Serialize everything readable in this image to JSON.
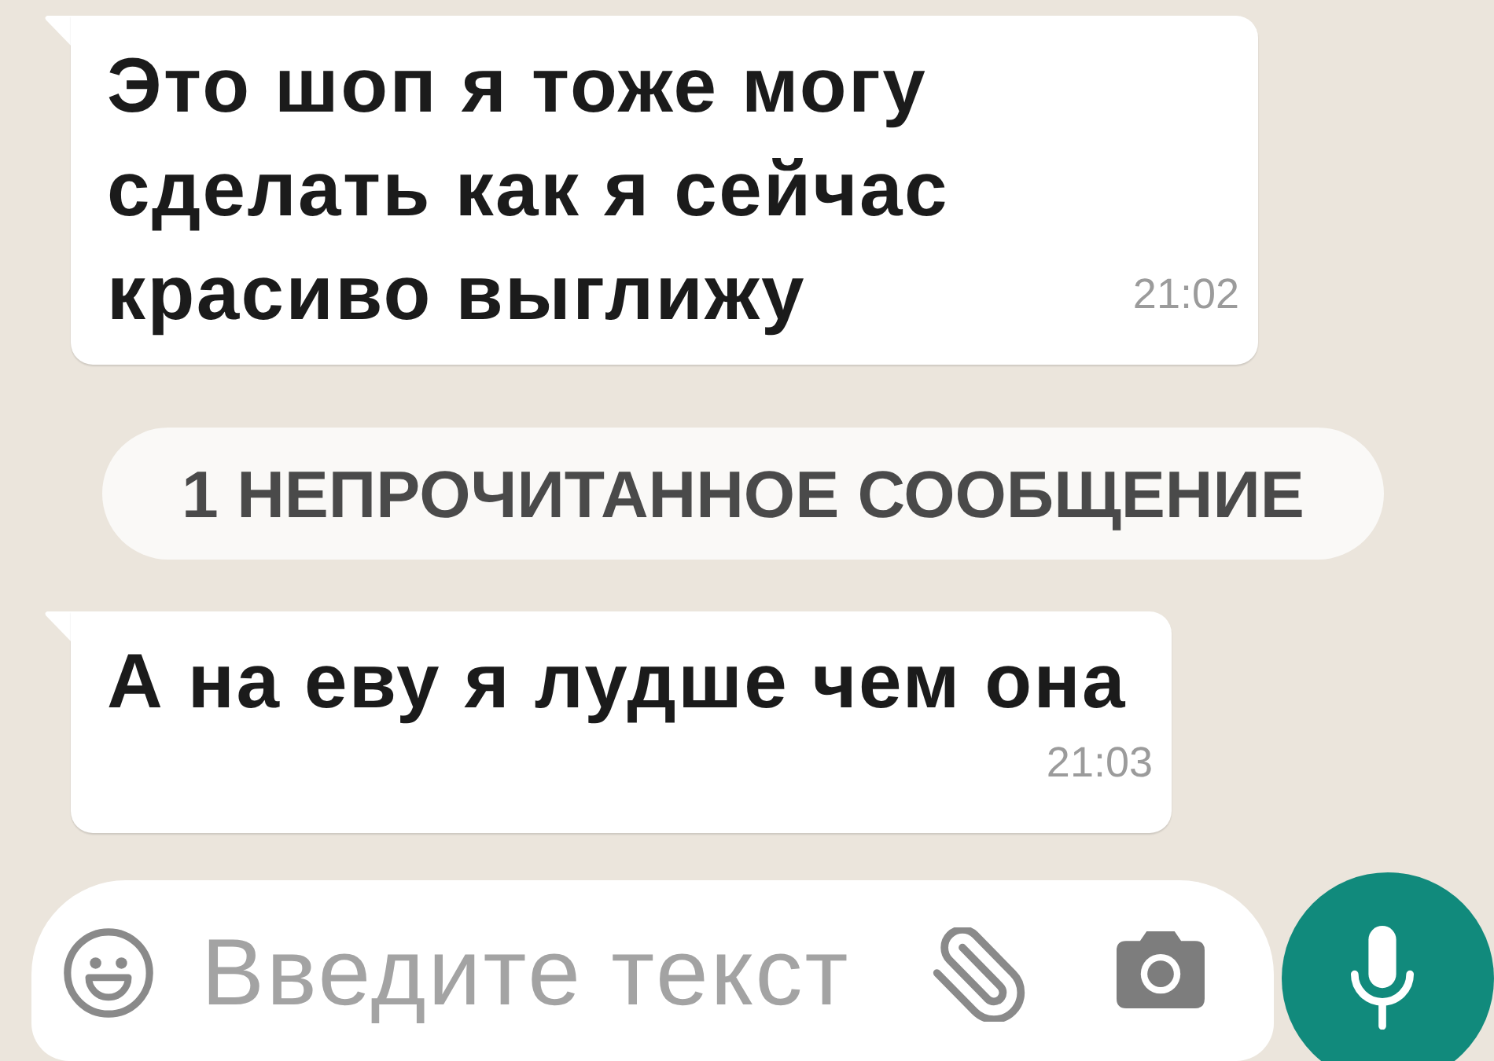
{
  "chat": [
    {
      "kind": "message",
      "text": "Это шоп я тоже могу\nсделать как я сейчас\nкрасиво выглижу",
      "time": "21:02"
    },
    {
      "kind": "unread_divider",
      "text": "1 НЕПРОЧИТАННОЕ СООБЩЕНИЕ"
    },
    {
      "kind": "message",
      "text": "А на еву я лудше чем она",
      "time": "21:03"
    }
  ],
  "composer": {
    "placeholder": "Введите текст"
  }
}
